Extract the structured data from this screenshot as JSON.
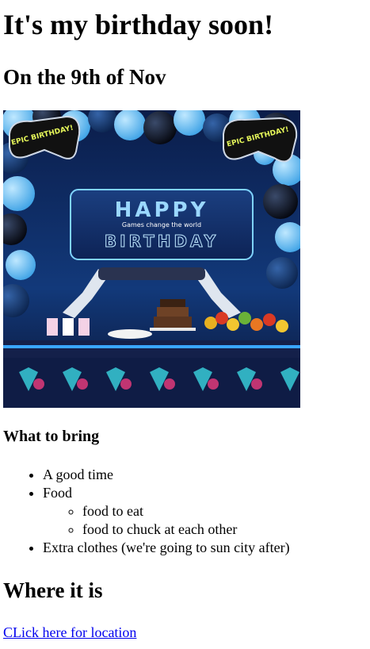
{
  "page": {
    "title": "It's my birthday soon!",
    "subtitle": "On the 9th of Nov"
  },
  "banner": {
    "badge_text": "EPIC BIRTHDAY!",
    "headline": "HAPPY",
    "tagline": "Games change the world",
    "word": "BIRTHDAY"
  },
  "bring": {
    "heading": "What to bring",
    "items": [
      {
        "label": "A good time"
      },
      {
        "label": "Food",
        "subitems": [
          "food to eat",
          "food to chuck at each other"
        ]
      },
      {
        "label": "Extra clothes (we're going to sun city after)"
      }
    ]
  },
  "location": {
    "heading": "Where it is",
    "link_text": "CLick here for location"
  }
}
